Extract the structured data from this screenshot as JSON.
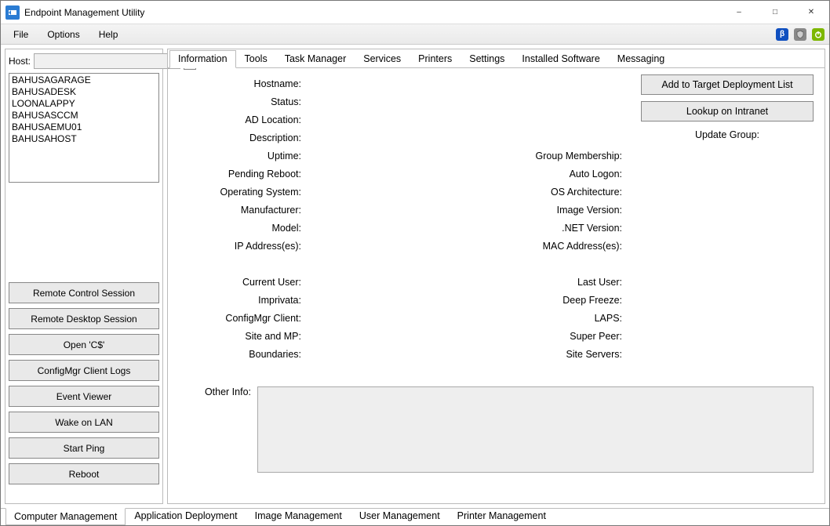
{
  "window_title": "Endpoint Management Utility",
  "menu": {
    "file": "File",
    "options": "Options",
    "help": "Help"
  },
  "menubar_icons": {
    "beta": "β"
  },
  "left": {
    "host_label": "Host:",
    "host_value": "",
    "hosts": [
      "BAHUSAGARAGE",
      "BAHUSADESK",
      "LOONALAPPY",
      "BAHUSASCCM",
      "BAHUSAEMU01",
      "BAHUSAHOST"
    ],
    "actions": {
      "remote_control": "Remote Control Session",
      "remote_desktop": "Remote Desktop Session",
      "open_c": "Open 'C$'",
      "cfgmgr_logs": "ConfigMgr Client Logs",
      "event_viewer": "Event Viewer",
      "wol": "Wake on LAN",
      "start_ping": "Start Ping",
      "reboot": "Reboot"
    }
  },
  "tabs": {
    "information": "Information",
    "tools": "Tools",
    "task_manager": "Task Manager",
    "services": "Services",
    "printers": "Printers",
    "settings": "Settings",
    "installed_sw": "Installed Software",
    "messaging": "Messaging"
  },
  "info": {
    "left_col": {
      "hostname": "Hostname:",
      "status": "Status:",
      "ad_location": "AD Location:",
      "description": "Description:",
      "uptime": "Uptime:",
      "pending_reboot": "Pending Reboot:",
      "os": "Operating System:",
      "manufacturer": "Manufacturer:",
      "model": "Model:",
      "ip": "IP Address(es):",
      "current_user": "Current User:",
      "imprivata": "Imprivata:",
      "cfgmgr_client": "ConfigMgr Client:",
      "site_mp": "Site and MP:",
      "boundaries": "Boundaries:"
    },
    "right_col": {
      "group_membership": "Group Membership:",
      "auto_logon": "Auto Logon:",
      "os_arch": "OS Architecture:",
      "image_version": "Image Version:",
      "net_version": ".NET Version:",
      "mac": "MAC Address(es):",
      "last_user": "Last User:",
      "deep_freeze": "Deep Freeze:",
      "laps": "LAPS:",
      "super_peer": "Super Peer:",
      "site_servers": "Site Servers:"
    },
    "buttons": {
      "add_target": "Add to Target Deployment List",
      "lookup": "Lookup on Intranet"
    },
    "update_group_label": "Update Group:",
    "other_info_label": "Other Info:"
  },
  "bottom_tabs": {
    "computer": "Computer Management",
    "app_deploy": "Application Deployment",
    "image_mgmt": "Image Management",
    "user_mgmt": "User Management",
    "printer_mgmt": "Printer Management"
  }
}
